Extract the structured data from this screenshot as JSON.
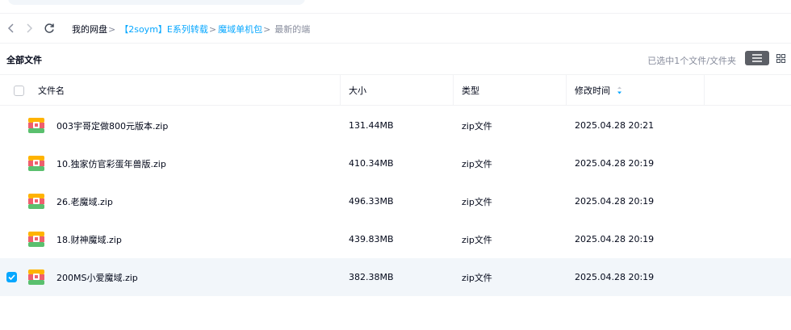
{
  "navbar": {
    "back_icon": "chevron-left-icon",
    "forward_icon": "chevron-right-icon",
    "refresh_icon": "refresh-icon",
    "breadcrumbs": [
      "我的网盘",
      "【2soym】E系列转载",
      "魔域单机包",
      "最新的端"
    ],
    "separator": ">"
  },
  "toolbar": {
    "title": "全部文件",
    "selected_info": "已选中1个文件/文件夹",
    "list_view_icon": "list-view-icon",
    "grid_view_icon": "grid-view-icon"
  },
  "table": {
    "columns": {
      "name": "文件名",
      "size": "大小",
      "type": "类型",
      "modified": "修改时间"
    },
    "sort_icon": "sort-desc-icon",
    "rows": [
      {
        "name": "003宇哥定做800元版本.zip",
        "size": "131.44MB",
        "type": "zip文件",
        "modified": "2025.04.28 20:21",
        "checked": false
      },
      {
        "name": "10.独家仿官彩蛋年兽版.zip",
        "size": "410.34MB",
        "type": "zip文件",
        "modified": "2025.04.28 20:19",
        "checked": false
      },
      {
        "name": "26.老魔域.zip",
        "size": "496.33MB",
        "type": "zip文件",
        "modified": "2025.04.28 20:19",
        "checked": false
      },
      {
        "name": "18.财神魔域.zip",
        "size": "439.83MB",
        "type": "zip文件",
        "modified": "2025.04.28 20:19",
        "checked": false
      },
      {
        "name": "200MS小爱魔域.zip",
        "size": "382.38MB",
        "type": "zip文件",
        "modified": "2025.04.28 20:19",
        "checked": true
      }
    ]
  },
  "colors": {
    "accent": "#06a7ff",
    "text": "#03081a",
    "muted": "#878c9c",
    "selected_row": "#f2f6fa"
  }
}
